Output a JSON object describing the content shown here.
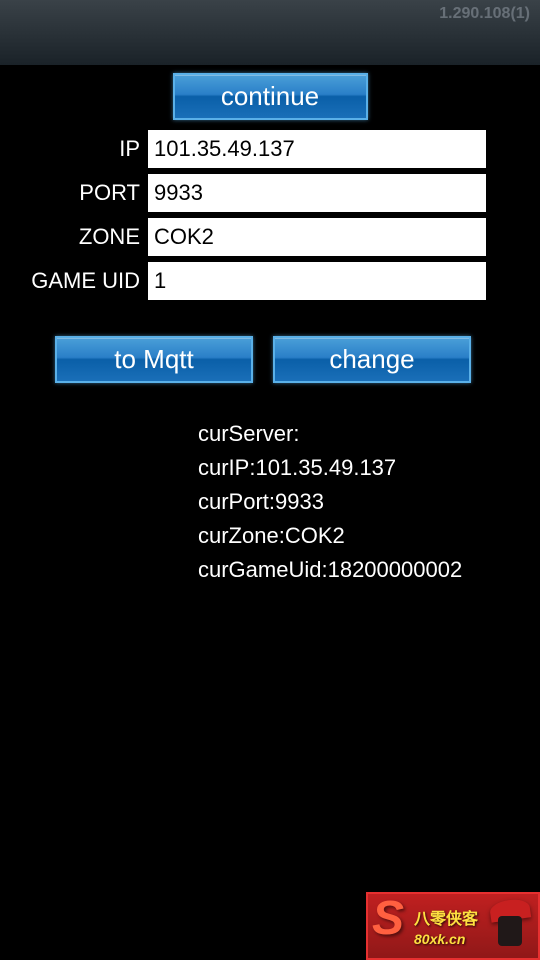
{
  "header": {
    "faded_text": "1.290.108(1)"
  },
  "buttons": {
    "continue_label": "continue",
    "to_mqtt_label": "to Mqtt",
    "change_label": "change"
  },
  "form": {
    "ip": {
      "label": "IP",
      "value": "101.35.49.137"
    },
    "port": {
      "label": "PORT",
      "value": "9933"
    },
    "zone": {
      "label": "ZONE",
      "value": "COK2"
    },
    "game_uid": {
      "label": "GAME UID",
      "value": "1"
    }
  },
  "status": {
    "curServer": "curServer:",
    "curIP": "curIP:101.35.49.137",
    "curPort": "curPort:9933",
    "curZone": "curZone:COK2",
    "curGameUid": "curGameUid:18200000002"
  },
  "watermark": {
    "cn": "八零侠客",
    "url": "80xk.cn"
  }
}
